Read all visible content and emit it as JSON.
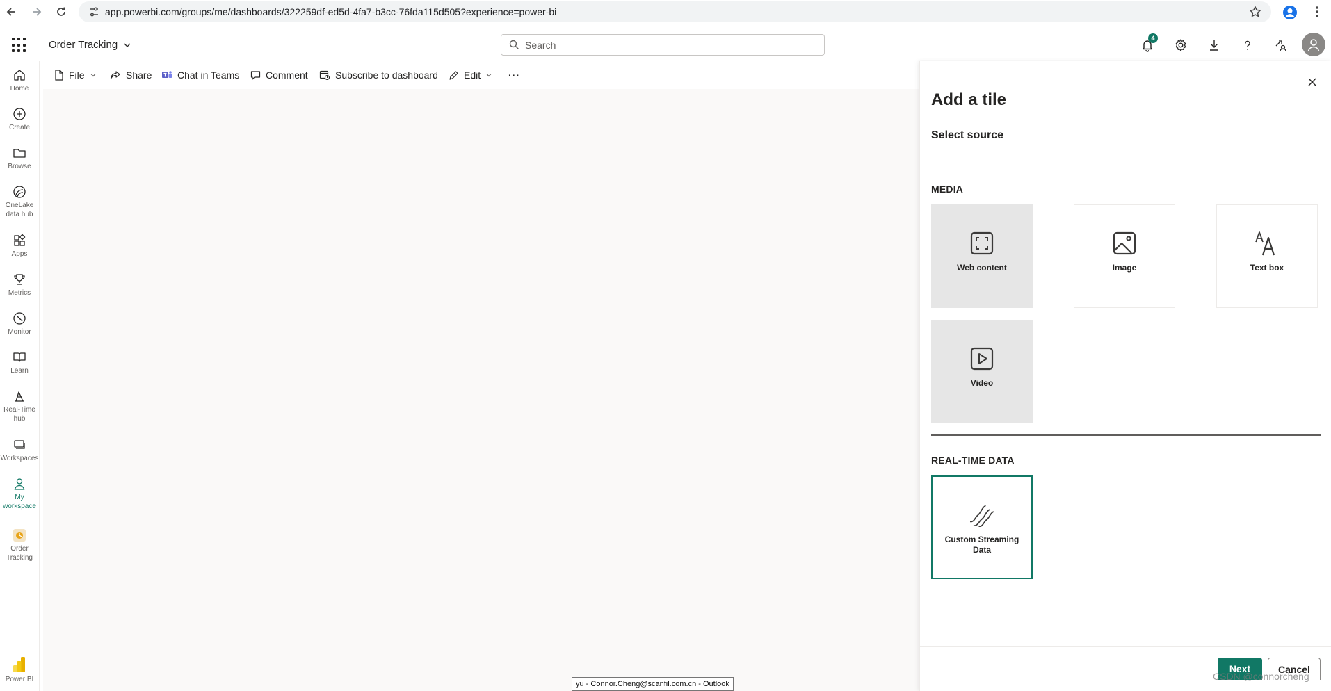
{
  "browser": {
    "url": "app.powerbi.com/groups/me/dashboards/322259df-ed5d-4fa7-b3cc-76fda115d505?experience=power-bi",
    "icons": [
      "back-icon",
      "forward-icon",
      "reload-icon",
      "site-settings-icon",
      "bookmark-star-icon",
      "profile-icon",
      "menu-kebab-icon"
    ]
  },
  "header": {
    "report_title": "Order Tracking",
    "search_placeholder": "Search",
    "notification_count": "4",
    "icons": [
      "app-launcher-icon",
      "bell-icon",
      "gear-icon",
      "download-icon",
      "help-icon",
      "share-feedback-icon",
      "account-icon"
    ]
  },
  "nav": {
    "items": [
      {
        "label": "Home",
        "icon": "home-icon"
      },
      {
        "label": "Create",
        "icon": "plus-circle-icon"
      },
      {
        "label": "Browse",
        "icon": "folder-icon"
      },
      {
        "label": "OneLake data hub",
        "label_lines": [
          "OneLake",
          "data hub"
        ],
        "icon": "onelake-icon"
      },
      {
        "label": "Apps",
        "icon": "apps-icon"
      },
      {
        "label": "Metrics",
        "icon": "trophy-icon"
      },
      {
        "label": "Monitor",
        "icon": "monitor-icon"
      },
      {
        "label": "Learn",
        "icon": "book-icon"
      },
      {
        "label": "Real-Time hub",
        "label_lines": [
          "Real-Time",
          "hub"
        ],
        "icon": "realtime-icon"
      },
      {
        "label": "Workspaces",
        "icon": "workspaces-icon"
      },
      {
        "label": "My workspace",
        "label_lines": [
          "My",
          "workspace"
        ],
        "icon": "person-icon"
      },
      {
        "label": "Order Tracking",
        "label_lines": [
          "Order",
          "Tracking"
        ],
        "icon": "dashboard-icon"
      }
    ],
    "brand_label": "Power BI"
  },
  "toolbar": {
    "file": "File",
    "share": "Share",
    "chat": "Chat in Teams",
    "comment": "Comment",
    "subscribe": "Subscribe to dashboard",
    "edit": "Edit",
    "more": "···"
  },
  "pane": {
    "title": "Add a tile",
    "subtitle": "Select source",
    "media_heading": "MEDIA",
    "media_tiles": [
      {
        "label": "Web content",
        "icon": "web-content-icon"
      },
      {
        "label": "Image",
        "icon": "image-icon"
      },
      {
        "label": "Text box",
        "icon": "text-box-icon"
      },
      {
        "label": "Video",
        "icon": "video-icon"
      }
    ],
    "realtime_heading": "REAL-TIME DATA",
    "realtime_tiles": [
      {
        "label": "Custom Streaming Data",
        "label_lines": [
          "Custom Streaming",
          "Data"
        ],
        "icon": "streaming-icon",
        "selected": true
      }
    ],
    "next_label": "Next",
    "cancel_label": "Cancel"
  },
  "tooltip": "yu - Connor.Cheng@scanfil.com.cn - Outlook",
  "watermark": "CSDN @connorcheng",
  "colors": {
    "accent": "#117865",
    "text": "#252423",
    "muted": "#605e5c",
    "tile_shaded": "#e6e6e6"
  }
}
